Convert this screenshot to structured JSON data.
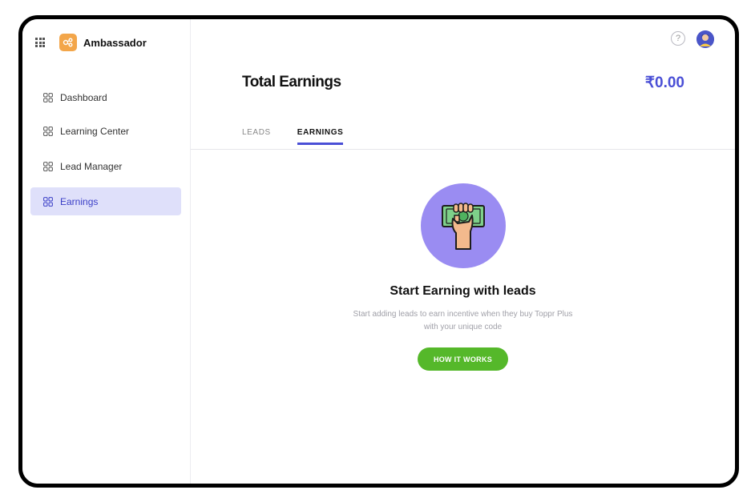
{
  "sidebar": {
    "brand": "Ambassador",
    "items": [
      {
        "label": "Dashboard",
        "icon": "grid-icon"
      },
      {
        "label": "Learning Center",
        "icon": "grid-icon"
      },
      {
        "label": "Lead Manager",
        "icon": "grid-icon"
      },
      {
        "label": "Earnings",
        "icon": "grid-icon",
        "active": true
      }
    ]
  },
  "header": {
    "help_symbol": "?"
  },
  "main": {
    "title": "Total Earnings",
    "amount": "₹0.00",
    "tabs": [
      {
        "label": "LEADS",
        "active": false
      },
      {
        "label": "EARNINGS",
        "active": true
      }
    ],
    "empty_state": {
      "title": "Start Earning with leads",
      "description": "Start adding leads to earn incentive when they buy Toppr Plus with your unique code",
      "button": "HOW IT WORKS"
    }
  },
  "colors": {
    "accent": "#4a4fd6",
    "active_bg": "#dfe0fa",
    "button_green": "#55b82a",
    "illustration_bg": "#9a8cf2",
    "logo_orange": "#f3a64a"
  }
}
